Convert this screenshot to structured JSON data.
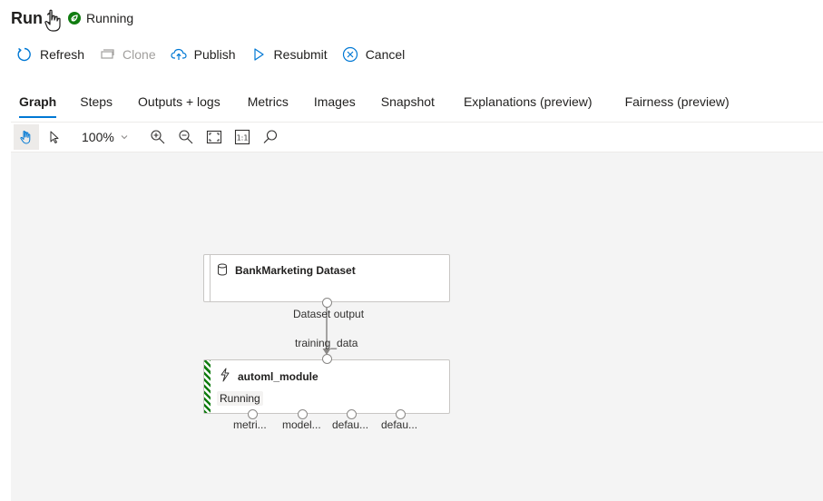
{
  "header": {
    "title": "Run",
    "run_number": "1",
    "status": "Running",
    "status_color": "#107c10"
  },
  "toolbar": {
    "refresh": "Refresh",
    "clone": "Clone",
    "publish": "Publish",
    "resubmit": "Resubmit",
    "cancel": "Cancel"
  },
  "tabs": [
    "Graph",
    "Steps",
    "Outputs + logs",
    "Metrics",
    "Images",
    "Snapshot",
    "Explanations (preview)",
    "Fairness (preview)"
  ],
  "active_tab": "Graph",
  "canvas_toolbar": {
    "zoom": "100%"
  },
  "graph": {
    "dataset_node": {
      "title": "BankMarketing Dataset",
      "output_label": "Dataset output"
    },
    "module_node": {
      "title": "automl_module",
      "input_label": "training_data",
      "status": "Running",
      "outputs": [
        "metri...",
        "model...",
        "defau...",
        "defau..."
      ]
    }
  },
  "accent_color": "#0078d4"
}
